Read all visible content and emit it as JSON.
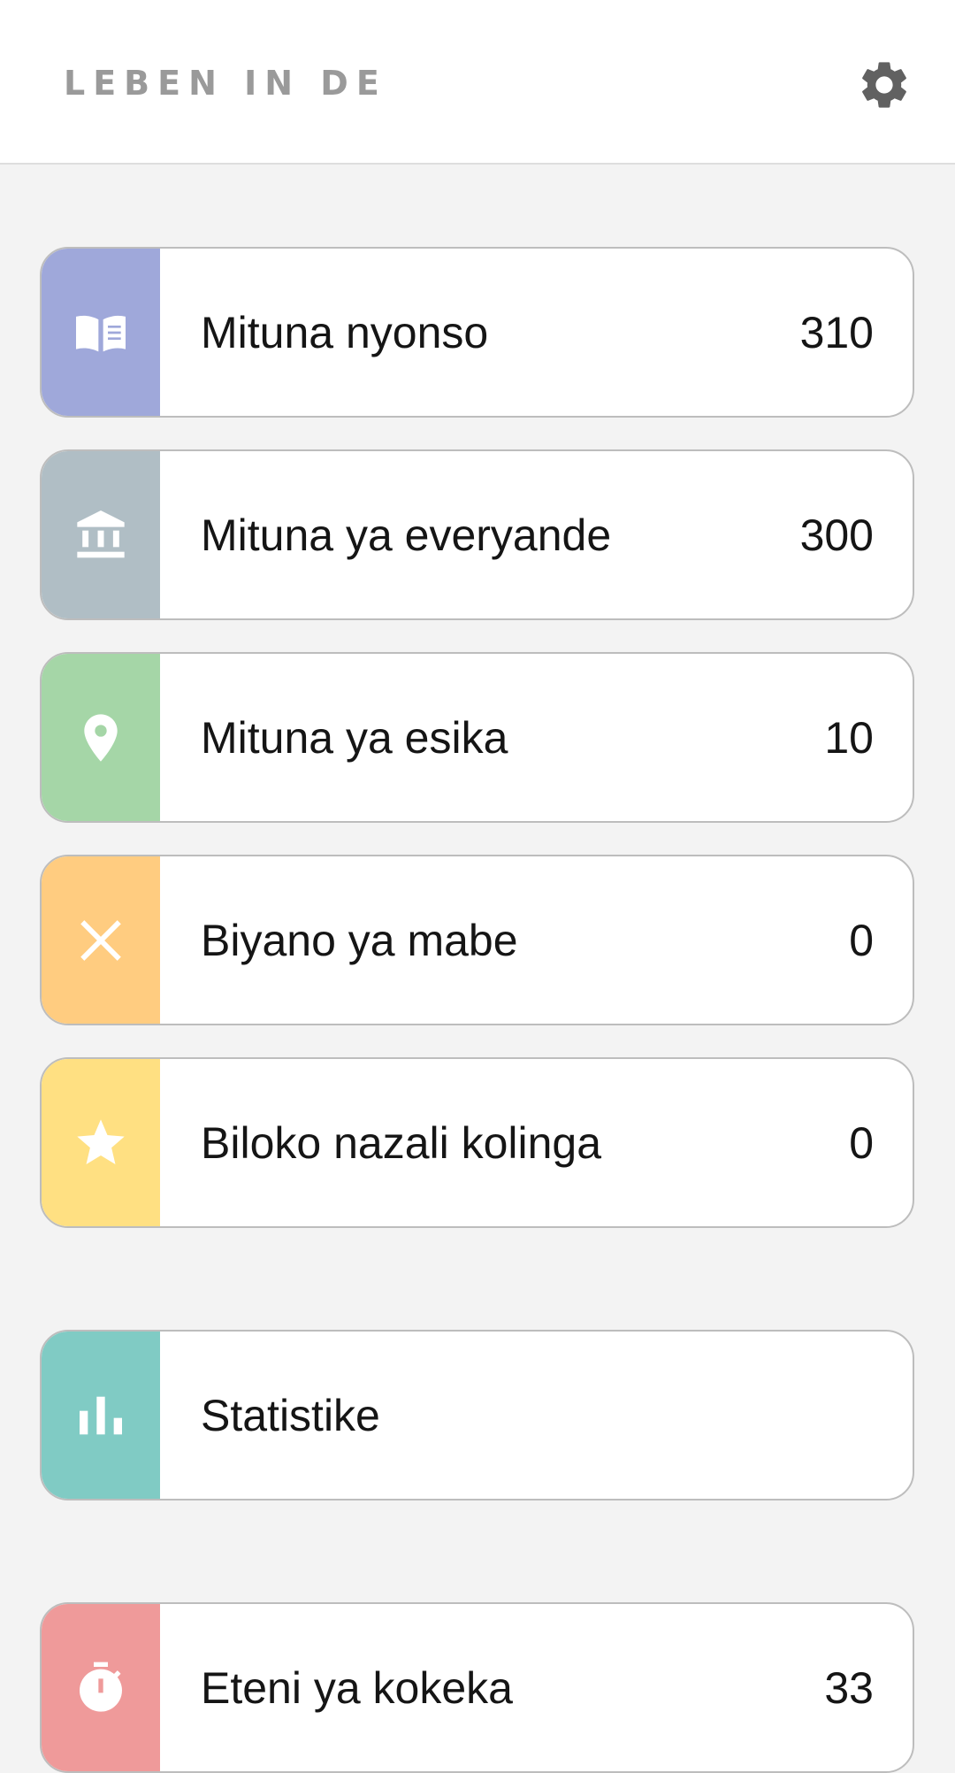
{
  "app": {
    "title": "LEBEN IN DE"
  },
  "header": {
    "settings_icon": "gear-icon"
  },
  "menu": [
    {
      "label": "Mituna nyonso",
      "count": "310",
      "icon": "book-open-icon",
      "color": "#9fa8da"
    },
    {
      "label": "Mituna ya everyande",
      "count": "300",
      "icon": "bank-building-icon",
      "color": "#b0bec5"
    },
    {
      "label": "Mituna ya esika",
      "count": "10",
      "icon": "map-pin-icon",
      "color": "#a5d6a7"
    },
    {
      "label": "Biyano ya mabe",
      "count": "0",
      "icon": "close-x-icon",
      "color": "#ffcc80"
    },
    {
      "label": "Biloko nazali kolinga",
      "count": "0",
      "icon": "star-icon",
      "color": "#ffe082"
    }
  ],
  "stats": {
    "label": "Statistike",
    "icon": "bar-chart-icon",
    "color": "#80cbc4"
  },
  "exam": {
    "label": "Eteni ya kokeka",
    "count": "33",
    "icon": "stopwatch-icon",
    "color": "#ef9a9a"
  }
}
